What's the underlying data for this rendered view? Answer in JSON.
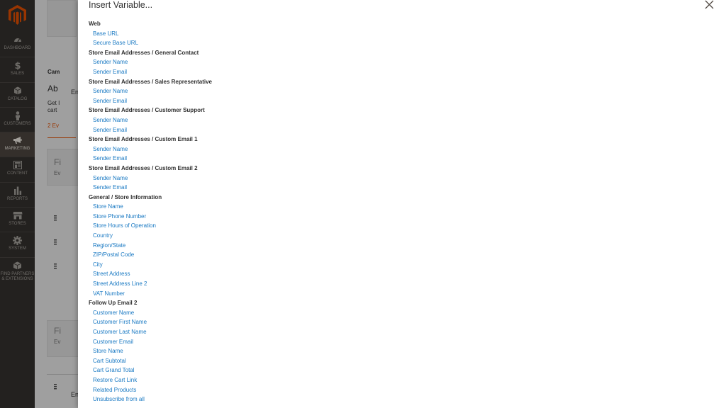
{
  "sidebar": {
    "items": [
      {
        "label": "DASHBOARD",
        "icon": "dashboard-icon"
      },
      {
        "label": "SALES",
        "icon": "dollar-icon"
      },
      {
        "label": "CATALOG",
        "icon": "cube-icon"
      },
      {
        "label": "CUSTOMERS",
        "icon": "person-icon"
      },
      {
        "label": "MARKETING",
        "icon": "megaphone-icon",
        "active": true
      },
      {
        "label": "CONTENT",
        "icon": "layout-icon"
      },
      {
        "label": "REPORTS",
        "icon": "bar-chart-icon"
      },
      {
        "label": "STORES",
        "icon": "store-icon"
      },
      {
        "label": "SYSTEM",
        "icon": "gear-icon"
      },
      {
        "label": "FIND PARTNERS & EXTENSIONS",
        "icon": "puzzle-icon"
      }
    ]
  },
  "background": {
    "t1": "Cam",
    "t2": "Ab",
    "t3": "Get I",
    "t4": "cart",
    "t5": "2 Ev",
    "t6": "En",
    "t7": "Fi",
    "t8": "Ev",
    "t9": "Fi",
    "t10": "Ev",
    "t11": "En"
  },
  "modal": {
    "title": "Insert Variable...",
    "groups": [
      {
        "title": "Web",
        "items": [
          "Base URL",
          "Secure Base URL"
        ]
      },
      {
        "title": "Store Email Addresses / General Contact",
        "items": [
          "Sender Name",
          "Sender Email"
        ]
      },
      {
        "title": "Store Email Addresses / Sales Representative",
        "items": [
          "Sender Name",
          "Sender Email"
        ]
      },
      {
        "title": "Store Email Addresses / Customer Support",
        "items": [
          "Sender Name",
          "Sender Email"
        ]
      },
      {
        "title": "Store Email Addresses / Custom Email 1",
        "items": [
          "Sender Name",
          "Sender Email"
        ]
      },
      {
        "title": "Store Email Addresses / Custom Email 2",
        "items": [
          "Sender Name",
          "Sender Email"
        ]
      },
      {
        "title": "General / Store Information",
        "items": [
          "Store Name",
          "Store Phone Number",
          "Store Hours of Operation",
          "Country",
          "Region/State",
          "ZIP/Postal Code",
          "City",
          "Street Address",
          "Street Address Line 2",
          "VAT Number"
        ]
      },
      {
        "title": "Follow Up Email 2",
        "items": [
          "Customer Name",
          "Customer First Name",
          "Customer Last Name",
          "Customer Email",
          "Store Name",
          "Cart Subtotal",
          "Cart Grand Total",
          "Restore Cart Link",
          "Related Products",
          "Unsubscribe from all"
        ]
      }
    ]
  },
  "colors": {
    "sidebar": "#373330",
    "accent": "#eb5202",
    "link": "#1979c3"
  }
}
